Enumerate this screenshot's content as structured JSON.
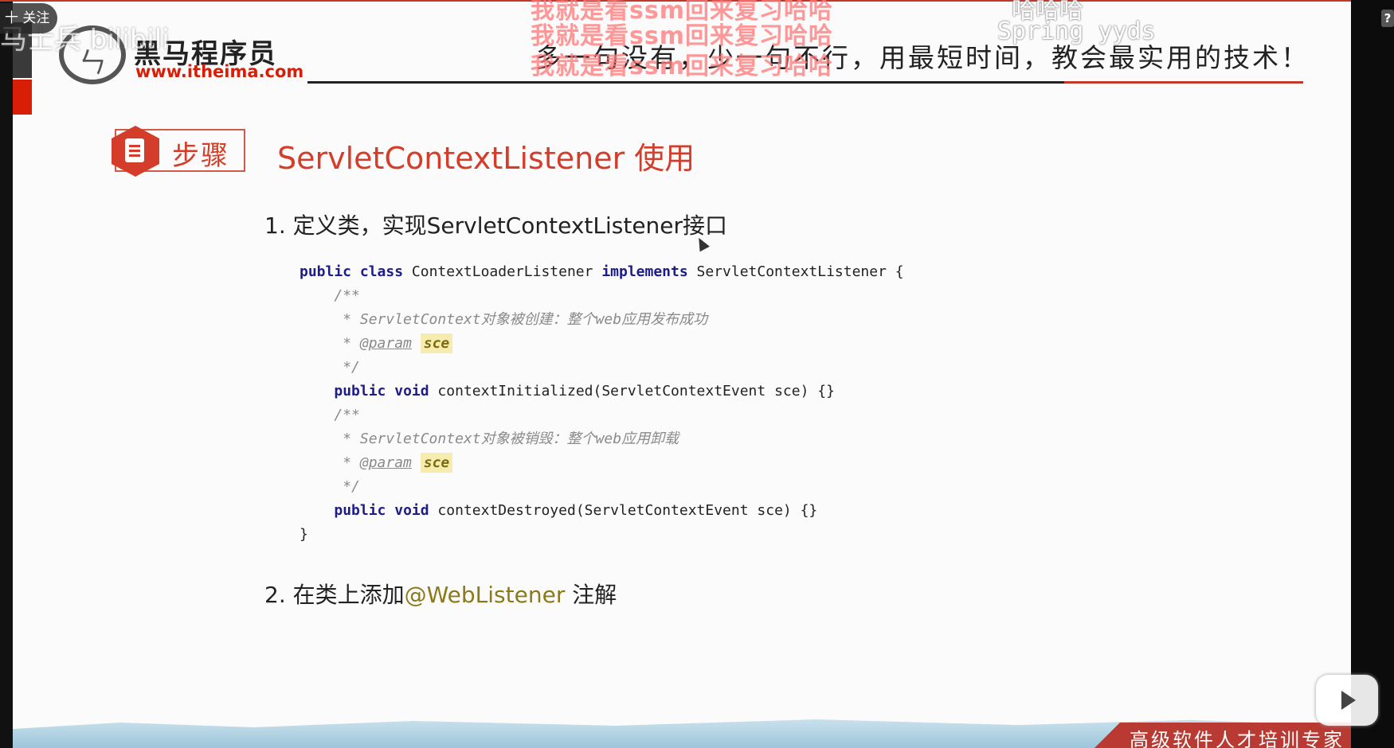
{
  "overlay": {
    "follow_label": "十 关注",
    "help_glyph": "?",
    "watermark_text": "马士兵 bilibili"
  },
  "header": {
    "logo_cn": "黑马程序员",
    "logo_url": "www.itheima.com",
    "slogan": "多一句没有，少一句不行，用最短时间，教会最实用的技术！"
  },
  "danmaku": [
    "我就是看ssm回来复习哈哈",
    "我就是看ssm回来复习哈哈",
    "我就是看ssm回来复习哈哈",
    "哈哈哈",
    "Spring yyds"
  ],
  "section": {
    "badge_label": "步骤",
    "title": "ServletContextListener 使用"
  },
  "steps": {
    "step1": "1. 定义类，实现ServletContextListener接口",
    "step2_prefix": "2. 在类上添加",
    "step2_annotation": "@WebListener",
    "step2_suffix": " 注解"
  },
  "code": {
    "kw_public": "public",
    "kw_class": "class",
    "kw_implements": "implements",
    "kw_void": "void",
    "class_name": " ContextLoaderListener ",
    "interface_name": " ServletContextListener {",
    "doc_open": "/**",
    "doc_close": "*/",
    "doc_init": "* ServletContext对象被创建：整个web应用发布成功",
    "doc_destroy": "* ServletContext对象被销毁：整个web应用卸载",
    "param_prefix": "* ",
    "param_tag": "@param",
    "param_name": "sce",
    "method_init": " contextInitialized(ServletContextEvent sce) {}",
    "method_destroy": " contextDestroyed(ServletContextEvent sce) {}",
    "close_brace": "}"
  },
  "footer": {
    "tagline": "高级软件人才培训专家"
  },
  "colors": {
    "brand_red": "#d43d2a",
    "keyword_blue": "#1c1c8c",
    "annotation_olive": "#8a7a1a"
  }
}
